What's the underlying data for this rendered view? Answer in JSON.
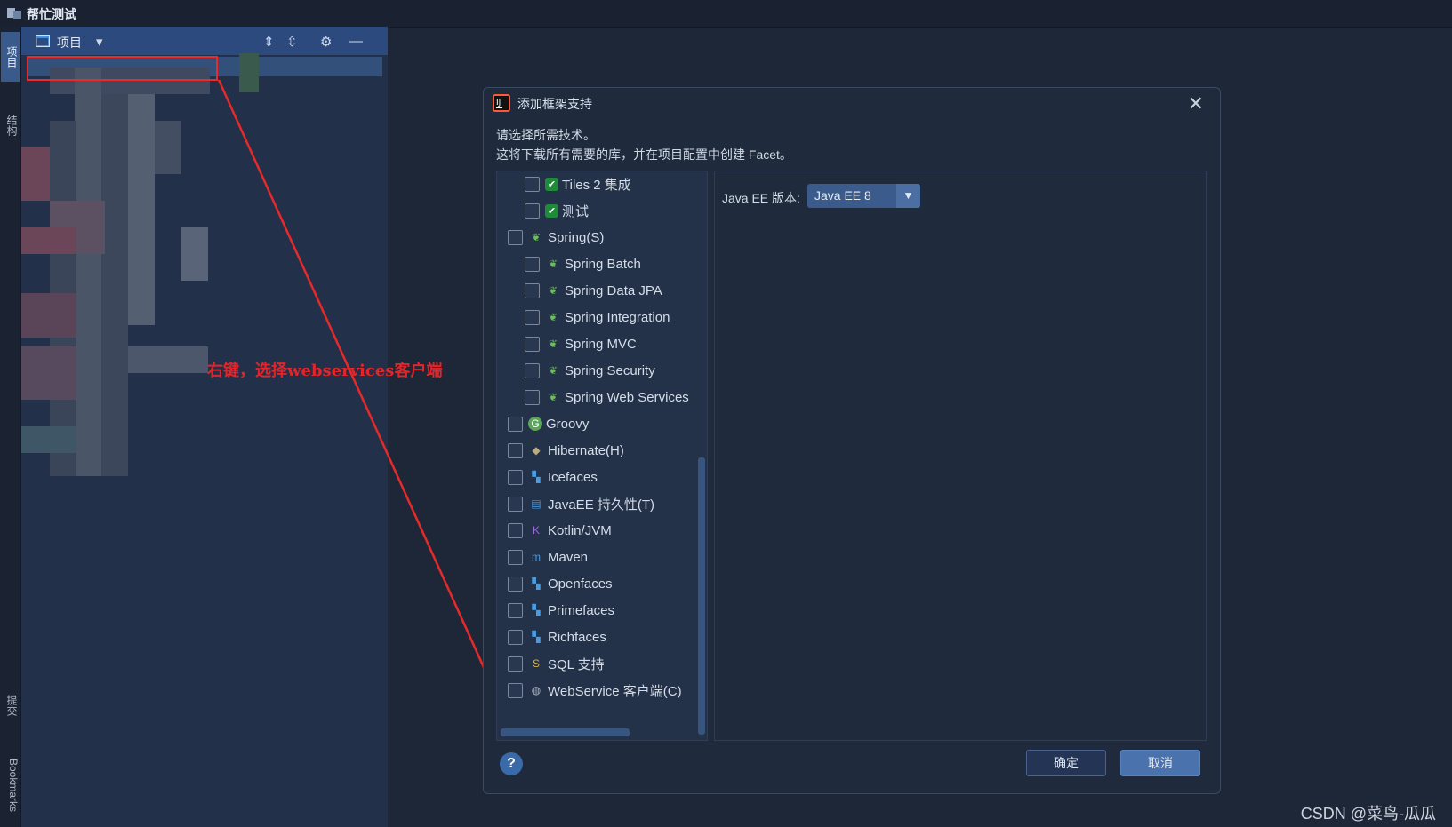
{
  "window": {
    "title": "帮忙测试"
  },
  "left_strip": {
    "tabs": [
      "项目",
      "结构",
      "提交",
      "Bookmarks"
    ]
  },
  "project_panel": {
    "title": "项目"
  },
  "annotation": {
    "text": "右键，选择webservices客户端"
  },
  "dialog": {
    "title": "添加框架支持",
    "line1": "请选择所需技术。",
    "line2": "这将下载所有需要的库，并在项目配置中创建 Facet。",
    "items": [
      {
        "label": "Tiles 2 集成",
        "indent": true,
        "icon": "check-badge-icon",
        "iconColor": "#1f8b3a"
      },
      {
        "label": "测试",
        "indent": true,
        "icon": "check-badge-icon",
        "iconColor": "#1f8b3a"
      },
      {
        "label": "Spring(S)",
        "indent": false,
        "icon": "spring-leaf-icon",
        "iconColor": "#6cbf5a"
      },
      {
        "label": "Spring Batch",
        "indent": true,
        "icon": "spring-batch-icon",
        "iconColor": "#6cbf5a"
      },
      {
        "label": "Spring Data JPA",
        "indent": true,
        "icon": "spring-data-icon",
        "iconColor": "#6cbf5a"
      },
      {
        "label": "Spring Integration",
        "indent": true,
        "icon": "spring-integration-icon",
        "iconColor": "#6cbf5a"
      },
      {
        "label": "Spring MVC",
        "indent": true,
        "icon": "spring-mvc-icon",
        "iconColor": "#6cbf5a"
      },
      {
        "label": "Spring Security",
        "indent": true,
        "icon": "spring-security-icon",
        "iconColor": "#6cbf5a"
      },
      {
        "label": "Spring Web Services",
        "indent": true,
        "icon": "spring-ws-icon",
        "iconColor": "#6cbf5a"
      },
      {
        "label": "Groovy",
        "indent": false,
        "icon": "groovy-icon",
        "iconColor": "#5aa55a"
      },
      {
        "label": "Hibernate(H)",
        "indent": false,
        "icon": "hibernate-icon",
        "iconColor": "#b9ac7e"
      },
      {
        "label": "Icefaces",
        "indent": false,
        "icon": "jsf-icon",
        "iconColor": "#4a9be0"
      },
      {
        "label": "JavaEE 持久性(T)",
        "indent": false,
        "icon": "persistence-icon",
        "iconColor": "#4a9be0"
      },
      {
        "label": "Kotlin/JVM",
        "indent": false,
        "icon": "kotlin-icon",
        "iconColor": "#9a6bdb"
      },
      {
        "label": "Maven",
        "indent": false,
        "icon": "maven-icon",
        "iconColor": "#4a9be0"
      },
      {
        "label": "Openfaces",
        "indent": false,
        "icon": "jsf-icon",
        "iconColor": "#4a9be0"
      },
      {
        "label": "Primefaces",
        "indent": false,
        "icon": "jsf-icon",
        "iconColor": "#4a9be0"
      },
      {
        "label": "Richfaces",
        "indent": false,
        "icon": "jsf-icon",
        "iconColor": "#4a9be0"
      },
      {
        "label": "SQL 支持",
        "indent": false,
        "icon": "sql-icon",
        "iconColor": "#d7b23c"
      },
      {
        "label": "WebService 客户端(C)",
        "indent": false,
        "icon": "webservice-globe-icon",
        "iconColor": "#aab4c2"
      }
    ],
    "version_label": "Java EE 版本:",
    "version_value": "Java EE 8",
    "help": "?",
    "ok": "确定",
    "cancel": "取消"
  },
  "watermark": "CSDN @菜鸟-瓜瓜"
}
